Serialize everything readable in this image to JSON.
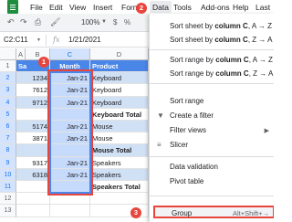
{
  "menubar": {
    "items": [
      "File",
      "Edit",
      "View",
      "Insert",
      "Form",
      "Data",
      "Tools",
      "Add-ons",
      "Help",
      "Last"
    ]
  },
  "toolbar": {
    "zoom": "100%",
    "currency": "$",
    "percent": "%"
  },
  "formula_bar": {
    "name_box": "C2:C11",
    "fx": "fx",
    "value": "1/21/2021"
  },
  "grid": {
    "columns": [
      "A",
      "B",
      "C",
      "D"
    ],
    "rows": [
      "1",
      "2",
      "3",
      "4",
      "5",
      "6",
      "7",
      "8",
      "9",
      "10",
      "11",
      "12",
      "13"
    ],
    "header": [
      "Sa",
      "Month",
      "Product"
    ],
    "data": [
      [
        "1234",
        "Jan-21",
        "Keyboard"
      ],
      [
        "7612",
        "Jan-21",
        "Keyboard"
      ],
      [
        "9712",
        "Jan-21",
        "Keyboard"
      ],
      [
        "",
        "",
        "Keyboard Total"
      ],
      [
        "5174",
        "Jan-21",
        "Mouse"
      ],
      [
        "3871",
        "Jan-21",
        "Mouse"
      ],
      [
        "",
        "",
        "Mouse Total"
      ],
      [
        "9317",
        "Jan-21",
        "Speakers"
      ],
      [
        "6318",
        "Jan-21",
        "Speakers"
      ],
      [
        "",
        "",
        "Speakers Total"
      ]
    ]
  },
  "data_menu": {
    "sort_sheet_az_prefix": "Sort sheet by ",
    "sort_sheet_az_bold": "column C",
    "sort_sheet_az_suffix": ", A → Z",
    "sort_sheet_za_prefix": "Sort sheet by ",
    "sort_sheet_za_bold": "column C",
    "sort_sheet_za_suffix": ", Z → A",
    "sort_range_az_prefix": "Sort range by ",
    "sort_range_az_bold": "column C",
    "sort_range_az_suffix": ", A → Z",
    "sort_range_za_prefix": "Sort range by ",
    "sort_range_za_bold": "column C",
    "sort_range_za_suffix": ", Z → A",
    "sort_range": "Sort range",
    "create_filter": "Create a filter",
    "filter_views": "Filter views",
    "slicer": "Slicer",
    "data_validation": "Data validation",
    "pivot_table": "Pivot table",
    "group": "Group",
    "group_shortcut": "Alt+Shift+→"
  },
  "callouts": [
    "1",
    "2",
    "3"
  ],
  "colors": {
    "accent": "#4a86e8",
    "header_fill": "#4a86e8",
    "callout": "#e8453c",
    "sheets_green": "#1e8e3e"
  }
}
